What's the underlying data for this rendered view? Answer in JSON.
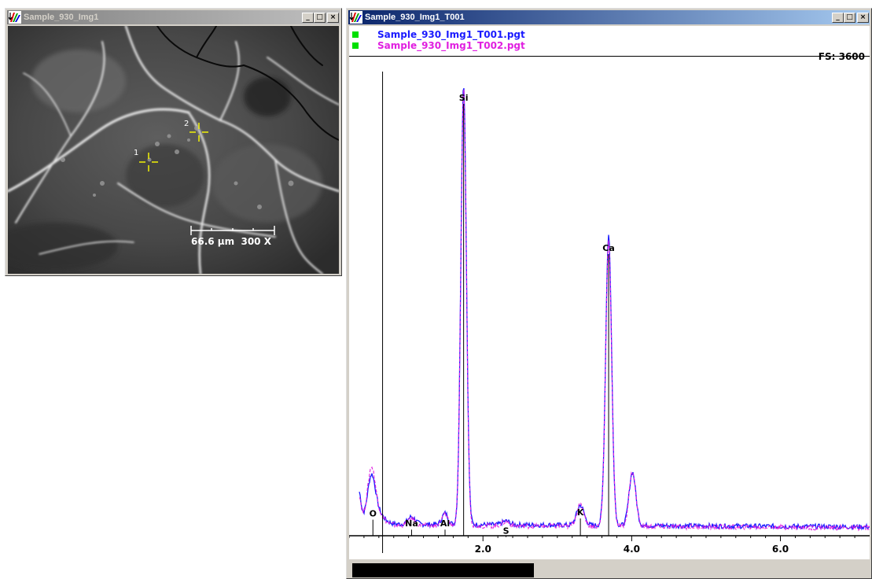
{
  "image_window": {
    "title": "Sample_930_Img1",
    "scale_label": "66.6 µm  300 X",
    "points": [
      {
        "label": "1"
      },
      {
        "label": "2"
      }
    ]
  },
  "spectrum_window": {
    "title": "Sample_930_Img1_T001",
    "legend": [
      {
        "name": "Sample_930_Img1_T001.pgt",
        "color": "#1a1aff"
      },
      {
        "name": "Sample_930_Img1_T002.pgt",
        "color": "#e020e0"
      }
    ],
    "full_scale": "FS: 3600"
  },
  "window_controls": {
    "minimize": "_",
    "maximize": "□",
    "close": "×"
  },
  "chart_data": {
    "type": "line",
    "xlim": [
      0.2,
      7.2
    ],
    "ylim": [
      0,
      3600
    ],
    "ticks": [
      {
        "value": 2.0,
        "label": "2.0"
      },
      {
        "value": 4.0,
        "label": "4.0"
      },
      {
        "value": 6.0,
        "label": "6.0"
      }
    ],
    "elements": [
      {
        "symbol": "O",
        "energy": 0.52,
        "height": 180
      },
      {
        "symbol": "Na",
        "energy": 1.04,
        "height": 100
      },
      {
        "symbol": "Al",
        "energy": 1.49,
        "height": 100
      },
      {
        "symbol": "Si",
        "energy": 1.74,
        "height": 3530
      },
      {
        "symbol": "S",
        "energy": 2.31,
        "height": 40
      },
      {
        "symbol": "K",
        "energy": 3.31,
        "height": 190
      },
      {
        "symbol": "Ca",
        "energy": 3.69,
        "height": 2320
      }
    ],
    "series": [
      {
        "name": "Sample_930_Img1_T001.pgt",
        "color": "#1a1aff",
        "peaks": [
          [
            0.33,
            250,
            0.03
          ],
          [
            0.5,
            290,
            0.05
          ],
          [
            0.54,
            120,
            0.1
          ],
          [
            1.04,
            60,
            0.05
          ],
          [
            1.49,
            90,
            0.04
          ],
          [
            1.74,
            3550,
            0.037
          ],
          [
            2.31,
            30,
            0.05
          ],
          [
            3.31,
            160,
            0.05
          ],
          [
            3.69,
            2340,
            0.04
          ],
          [
            4.01,
            430,
            0.045
          ]
        ],
        "background": 95
      },
      {
        "name": "Sample_930_Img1_T002.pgt",
        "color": "#e020e0",
        "peaks": [
          [
            0.33,
            230,
            0.03
          ],
          [
            0.5,
            350,
            0.05
          ],
          [
            0.54,
            130,
            0.1
          ],
          [
            1.04,
            55,
            0.05
          ],
          [
            1.49,
            95,
            0.04
          ],
          [
            1.74,
            3520,
            0.037
          ],
          [
            2.31,
            35,
            0.05
          ],
          [
            3.31,
            175,
            0.05
          ],
          [
            3.69,
            2300,
            0.04
          ],
          [
            4.01,
            440,
            0.045
          ]
        ],
        "background": 85
      }
    ],
    "cursor_energy": 0.65
  }
}
